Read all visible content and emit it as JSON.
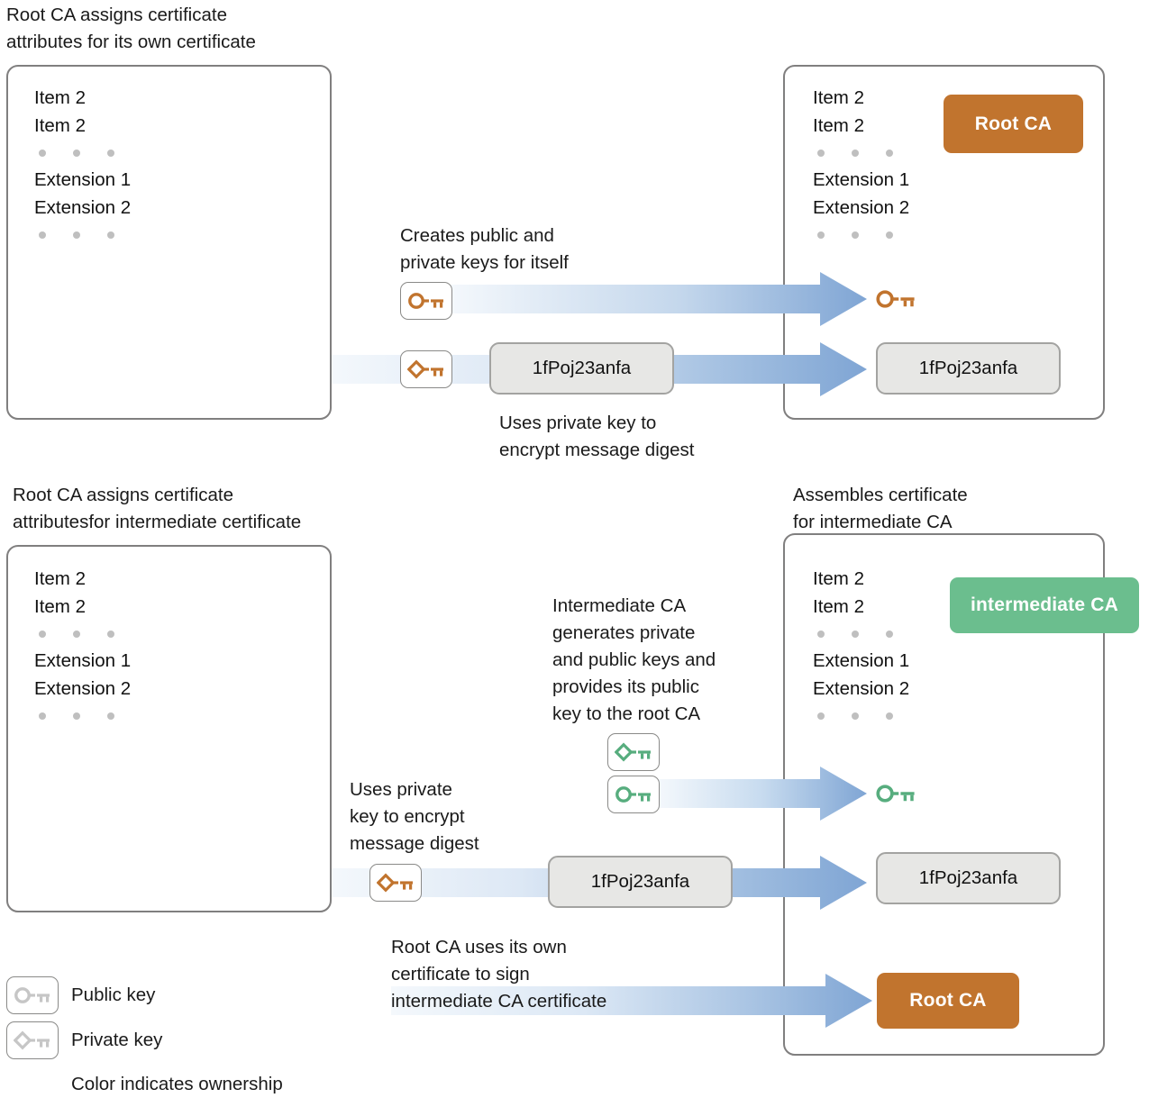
{
  "colors": {
    "root_ca": "#c1742e",
    "intermediate_ca": "#6bbe8e",
    "arrow_blue": "#7fa5d4",
    "arrow_blue_pale": "#f2f6fb",
    "key_orange": "#c1742e",
    "key_green": "#57ad7e",
    "key_gray": "#c6c6c6",
    "panel_border": "#807f7f",
    "digest_bg": "#e7e7e5",
    "text": "#1a1a1a"
  },
  "section1": {
    "left_caption": "Root CA assigns certificate\nattributes for its own certificate",
    "left_cert": {
      "items": [
        "Item 2",
        "Item 2"
      ],
      "extensions": [
        "Extension 1",
        "Extension 2"
      ]
    },
    "right_cert": {
      "items": [
        "Item 2",
        "Item 2"
      ],
      "extensions": [
        "Extension 1",
        "Extension 2"
      ],
      "badge": "Root CA",
      "digest": "1fPoj23anfa"
    },
    "annotation_keys": "Creates public and\nprivate keys for itself",
    "annotation_digest": "Uses private key to\nencrypt message digest",
    "public_key_icon": "public-key-icon",
    "private_key_icon": "private-key-icon",
    "digest": "1fPoj23anfa"
  },
  "section2": {
    "left_caption": "Root CA assigns certificate\nattributesfor intermediate certificate",
    "right_caption": "Assembles certificate\nfor intermediate CA",
    "left_cert": {
      "items": [
        "Item 2",
        "Item 2"
      ],
      "extensions": [
        "Extension 1",
        "Extension 2"
      ]
    },
    "right_cert": {
      "items": [
        "Item 2",
        "Item 2"
      ],
      "extensions": [
        "Extension 1",
        "Extension 2"
      ],
      "badge": "intermediate CA",
      "digest": "1fPoj23anfa",
      "sign_badge": "Root CA"
    },
    "annotation_intermediate_keys": "Intermediate CA\ngenerates private\nand public keys and\nprovides its public\nkey to the root CA",
    "annotation_digest": "Uses private\nkey to encrypt\nmessage digest",
    "annotation_sign": "Root CA uses its own\ncertificate to sign\nintermediate CA certificate",
    "digest": "1fPoj23anfa"
  },
  "legend": {
    "public_key_label": "Public key",
    "private_key_label": "Private key",
    "note": "Color indicates ownership"
  }
}
